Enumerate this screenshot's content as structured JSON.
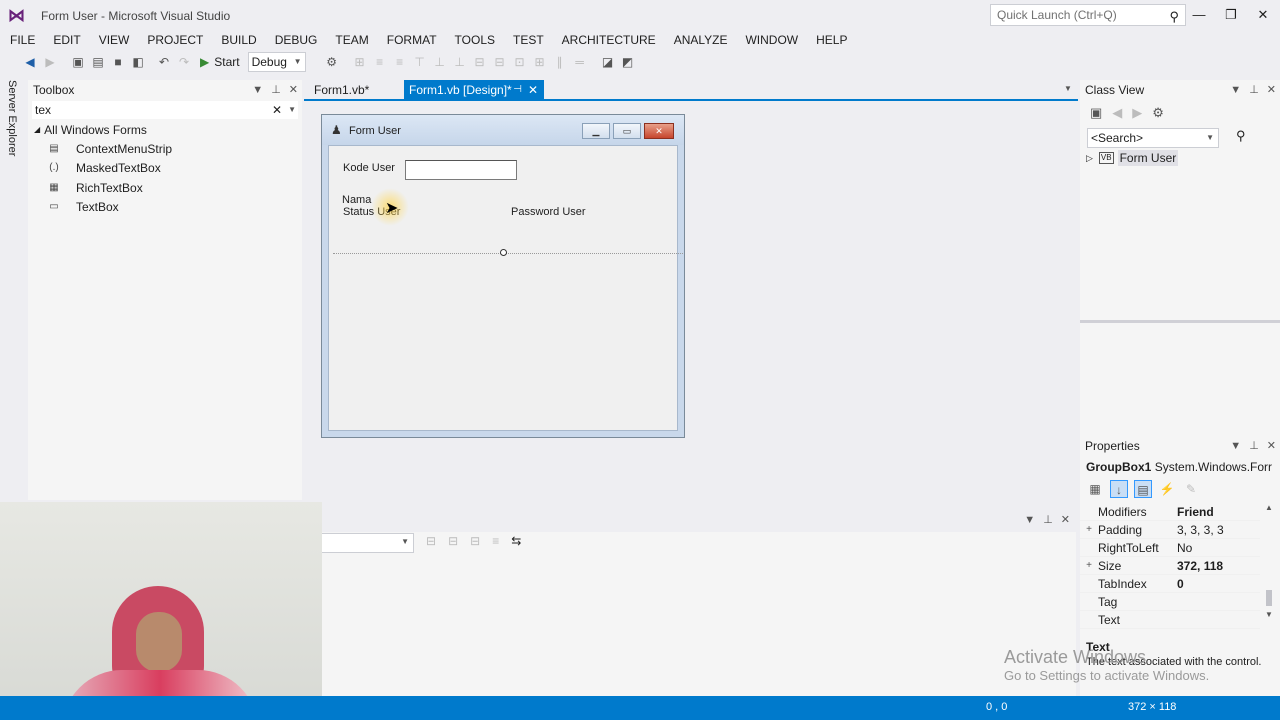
{
  "app": {
    "title": "Form User - Microsoft Visual Studio",
    "quick_launch_placeholder": "Quick Launch (Ctrl+Q)"
  },
  "menu": [
    "FILE",
    "EDIT",
    "VIEW",
    "PROJECT",
    "BUILD",
    "DEBUG",
    "TEAM",
    "FORMAT",
    "TOOLS",
    "TEST",
    "ARCHITECTURE",
    "ANALYZE",
    "WINDOW",
    "HELP"
  ],
  "toolbar": {
    "start_label": "Start",
    "config": "Debug"
  },
  "server_explorer": "Server Explorer",
  "toolbox": {
    "title": "Toolbox",
    "search": "tex",
    "group": "All Windows Forms",
    "items": [
      "ContextMenuStrip",
      "MaskedTextBox",
      "RichTextBox",
      "TextBox"
    ]
  },
  "tabs": {
    "form1vb": "Form1.vb*",
    "design": "Form1.vb [Design]*"
  },
  "form": {
    "title": "Form User",
    "labels": {
      "kode": "Kode User",
      "nama": "Nama",
      "status": "Status User",
      "password": "Password User"
    }
  },
  "class_view": {
    "title": "Class View",
    "search": "<Search>",
    "node": "Form User"
  },
  "properties": {
    "title": "Properties",
    "object_name": "GroupBox1",
    "object_type": "System.Windows.Forr",
    "rows": [
      {
        "name": "Modifiers",
        "value": "Friend",
        "bold": true,
        "expand": ""
      },
      {
        "name": "Padding",
        "value": "3, 3, 3, 3",
        "bold": false,
        "expand": "+"
      },
      {
        "name": "RightToLeft",
        "value": "No",
        "bold": false,
        "expand": ""
      },
      {
        "name": "Size",
        "value": "372, 118",
        "bold": true,
        "expand": "+"
      },
      {
        "name": "TabIndex",
        "value": "0",
        "bold": true,
        "expand": ""
      },
      {
        "name": "Tag",
        "value": "",
        "bold": false,
        "expand": ""
      },
      {
        "name": "Text",
        "value": "",
        "bold": false,
        "expand": ""
      }
    ],
    "desc_title": "Text",
    "desc": "The text associated with the control."
  },
  "watermark": {
    "line1": "Activate Windows",
    "line2": "Go to Settings to activate Windows."
  },
  "status": {
    "position": "0 , 0",
    "size": "372 × 118"
  },
  "colors": {
    "accent": "#007acc",
    "background": "#eeeef2"
  }
}
